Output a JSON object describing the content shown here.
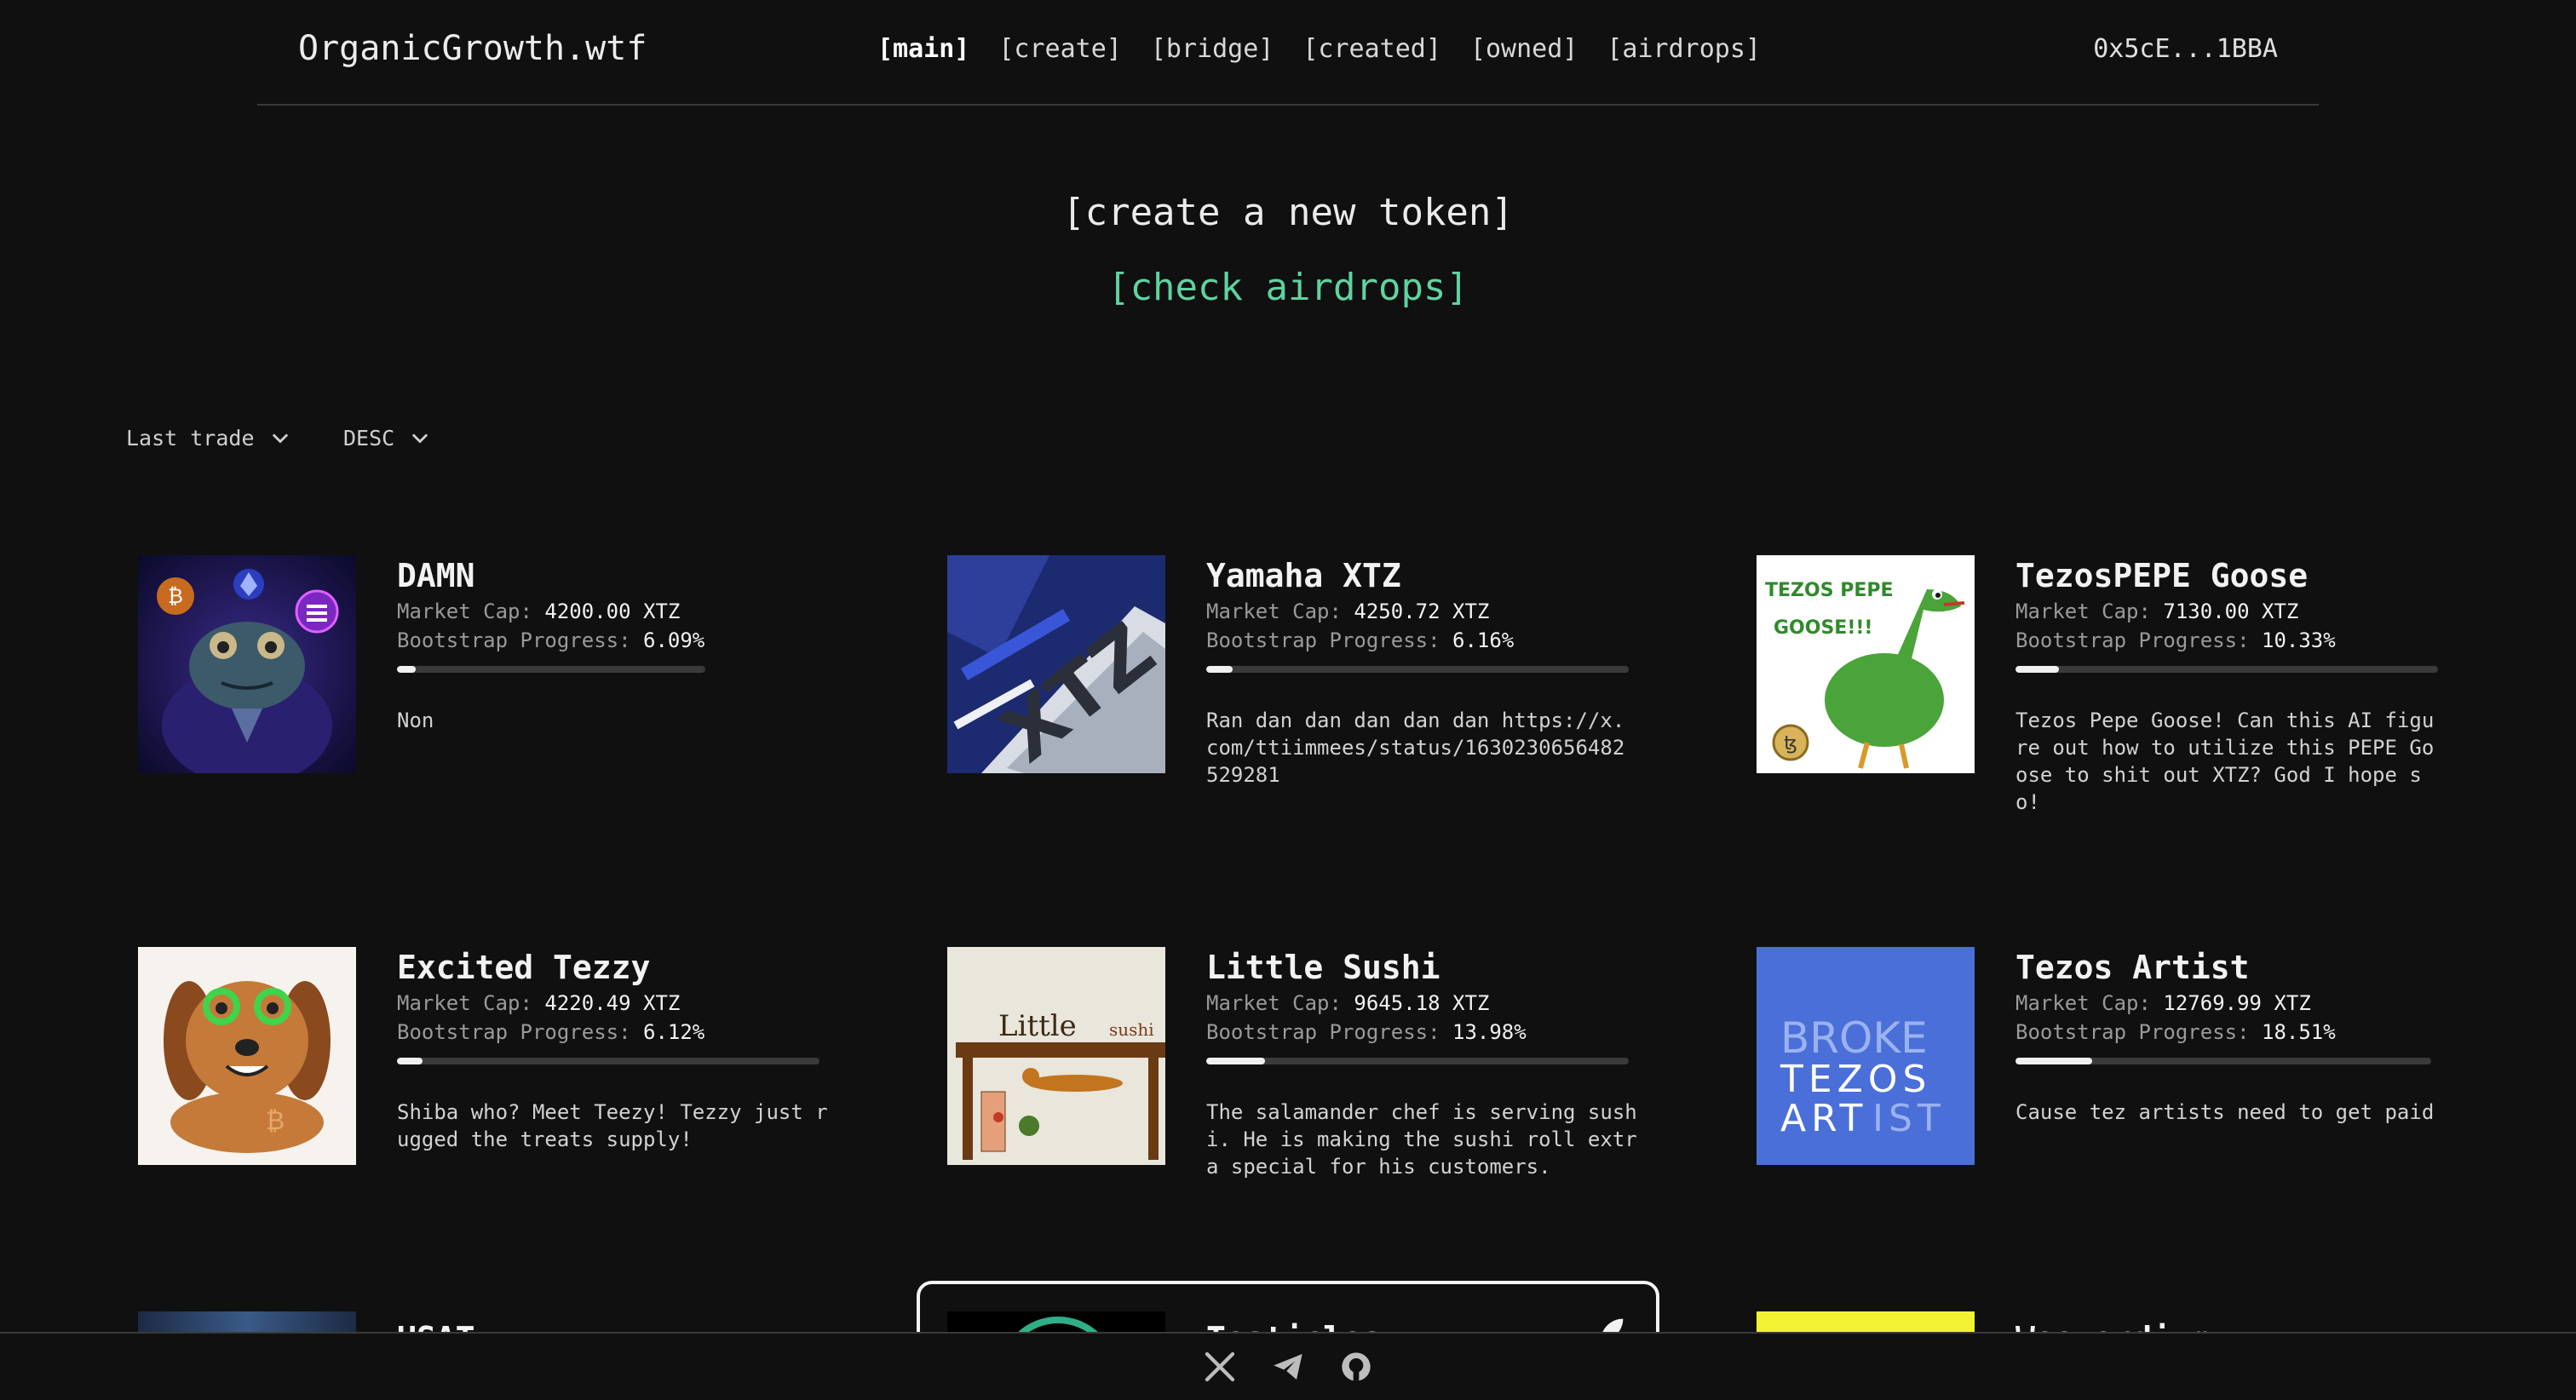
{
  "header": {
    "brand": "OrganicGrowth.wtf",
    "nav": [
      {
        "label": "[main]",
        "active": true
      },
      {
        "label": "[create]",
        "active": false
      },
      {
        "label": "[bridge]",
        "active": false
      },
      {
        "label": "[created]",
        "active": false
      },
      {
        "label": "[owned]",
        "active": false
      },
      {
        "label": "[airdrops]",
        "active": false
      }
    ],
    "wallet": "0x5cE...1BBA"
  },
  "hero": {
    "create_label": "[create a new token]",
    "airdrops_label": "[check airdrops]"
  },
  "sort": {
    "field": "Last trade",
    "order": "DESC"
  },
  "labels": {
    "market_cap": "Market Cap:",
    "bootstrap": "Bootstrap Progress:"
  },
  "tokens": [
    {
      "name": "DAMN",
      "market_cap": "4200.00 XTZ",
      "progress_text": "6.09%",
      "progress": 6.09,
      "description": "Non",
      "image_icon": "frog-monk-crypto-icon"
    },
    {
      "name": "Yamaha XTZ",
      "market_cap": "4250.72 XTZ",
      "progress_text": "6.16%",
      "progress": 6.16,
      "description": "Ran dan dan dan dan dan https://x.com/ttiimmees/status/1630230656482529281",
      "image_icon": "motorcycle-xtz-icon"
    },
    {
      "name": "TezosPEPE Goose",
      "market_cap": "7130.00 XTZ",
      "progress_text": "10.33%",
      "progress": 10.33,
      "description": "Tezos Pepe Goose! Can this AI figure out how to utilize this PEPE Goose to shit out XTZ? God I hope so!",
      "image_icon": "pepe-goose-icon"
    },
    {
      "name": "Excited Tezzy",
      "market_cap": "4220.49 XTZ",
      "progress_text": "6.12%",
      "progress": 6.12,
      "description": "Shiba who? Meet Teezy! Tezzy just rugged the treats supply!",
      "image_icon": "dachshund-glasses-icon"
    },
    {
      "name": "Little Sushi",
      "market_cap": "9645.18 XTZ",
      "progress_text": "13.98%",
      "progress": 13.98,
      "description": "The salamander chef is serving sushi. He is making the sushi roll extra special for his customers.",
      "image_icon": "salamander-sushi-icon"
    },
    {
      "name": "Tezos Artist",
      "market_cap": "12769.99 XTZ",
      "progress_text": "18.51%",
      "progress": 18.51,
      "description": "Cause tez artists need to get paid",
      "image_icon": "broke-tezos-artist-icon"
    }
  ],
  "peek_tokens": [
    {
      "name": "USAT",
      "image_icon": "usat-icon"
    },
    {
      "name": "Testicles",
      "image_icon": "testicles-icon"
    },
    {
      "name": "Weezerdium",
      "image_icon": "weezerdium-icon"
    }
  ],
  "footer": {
    "icons": [
      "x-icon",
      "telegram-icon",
      "github-icon"
    ]
  },
  "colors": {
    "background": "#101010",
    "accent_green": "#5fd3a0",
    "tezos_artist_blue": "#4a6fd8",
    "weezerdium_yellow": "#f2f233"
  }
}
